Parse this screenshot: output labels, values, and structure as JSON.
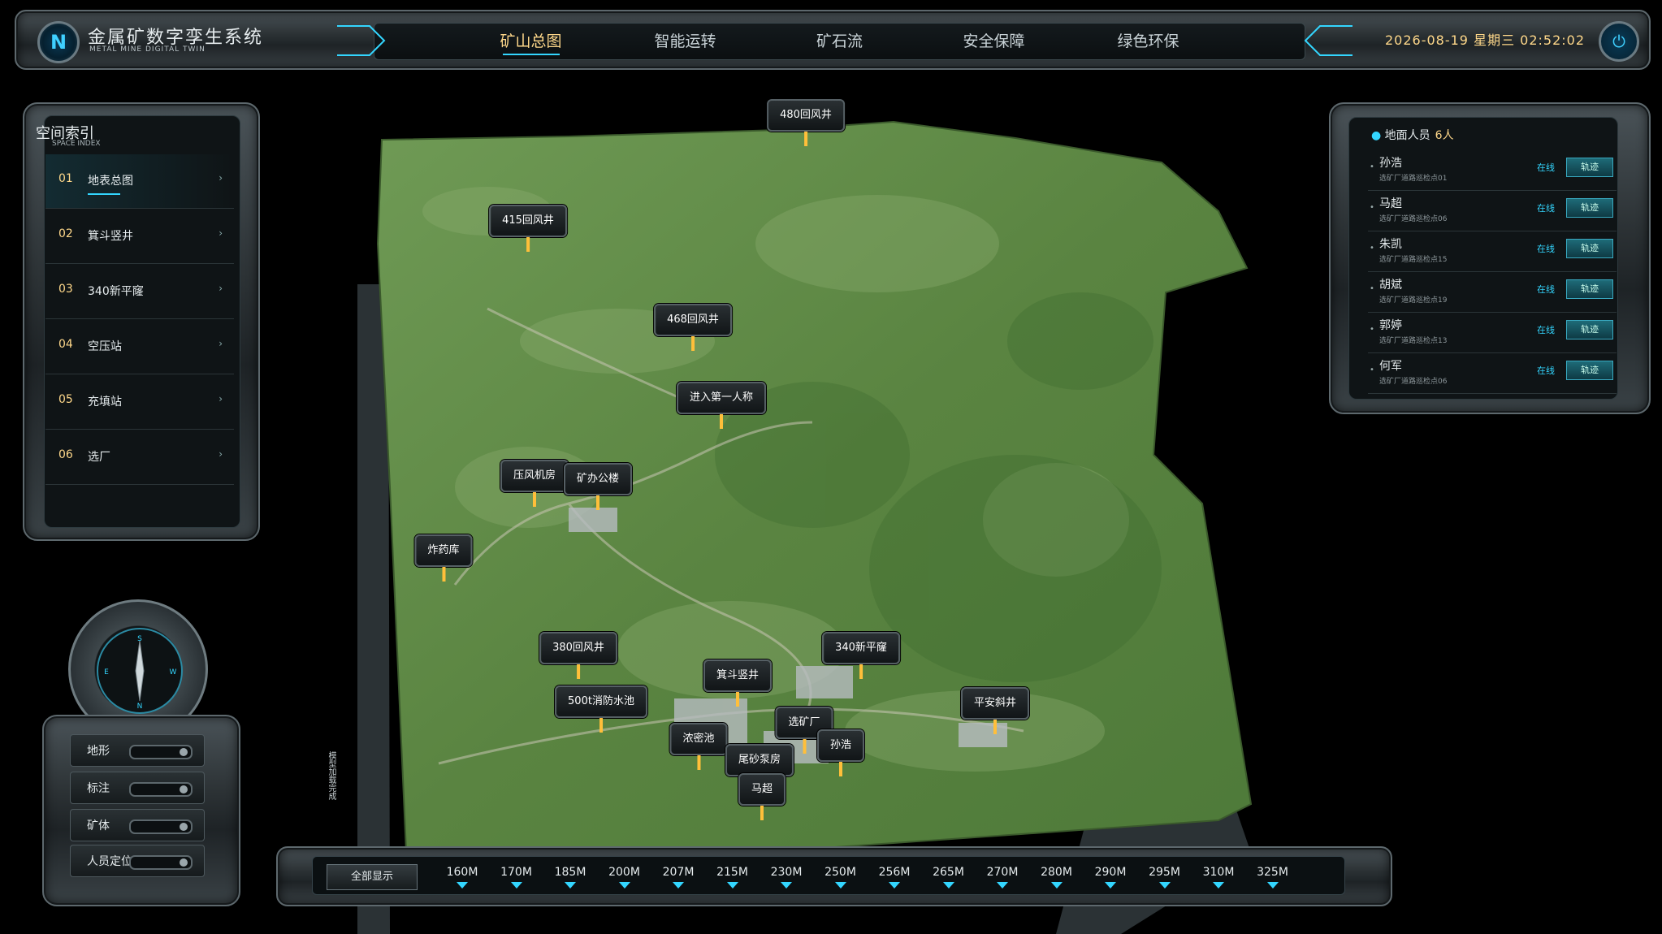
{
  "header": {
    "title": "金属矿数字孪生系统",
    "subtitle": "METAL MINE DIGITAL TWIN",
    "logo_letter": "N",
    "tabs": [
      {
        "label": "矿山总图",
        "active": true
      },
      {
        "label": "智能运转",
        "active": false
      },
      {
        "label": "矿石流",
        "active": false
      },
      {
        "label": "安全保障",
        "active": false
      },
      {
        "label": "绿色环保",
        "active": false
      }
    ],
    "datetime": "2026-08-19  星期三  02:52:02",
    "power_icon": "power-icon"
  },
  "index_panel": {
    "title": "空间索引",
    "subtitle": "SPACE INDEX",
    "items": [
      {
        "num": "01",
        "label": "地表总图",
        "active": true
      },
      {
        "num": "02",
        "label": "箕斗竖井",
        "active": false
      },
      {
        "num": "03",
        "label": "340新平窿",
        "active": false
      },
      {
        "num": "04",
        "label": "空压站",
        "active": false
      },
      {
        "num": "05",
        "label": "充填站",
        "active": false
      },
      {
        "num": "06",
        "label": "选厂",
        "active": false
      }
    ],
    "arrow": "›"
  },
  "people_panel": {
    "title": "地面人员",
    "count": "6人",
    "people": [
      {
        "name": "孙浩",
        "location": "选矿厂道路巡检点01",
        "status": "在线",
        "action": "轨迹"
      },
      {
        "name": "马超",
        "location": "选矿厂道路巡检点06",
        "status": "在线",
        "action": "轨迹"
      },
      {
        "name": "朱凯",
        "location": "选矿厂道路巡检点15",
        "status": "在线",
        "action": "轨迹"
      },
      {
        "name": "胡斌",
        "location": "选矿厂道路巡检点19",
        "status": "在线",
        "action": "轨迹"
      },
      {
        "name": "郭婷",
        "location": "选矿厂道路巡检点13",
        "status": "在线",
        "action": "轨迹"
      },
      {
        "name": "何军",
        "location": "选矿厂道路巡检点06",
        "status": "在线",
        "action": "轨迹"
      }
    ]
  },
  "map": {
    "markers": [
      {
        "label": "480回风井"
      },
      {
        "label": "415回风井"
      },
      {
        "label": "468回风井"
      },
      {
        "label": "进入第一人称"
      },
      {
        "label": "压风机房"
      },
      {
        "label": "矿办公楼"
      },
      {
        "label": "炸药库"
      },
      {
        "label": "380回风井"
      },
      {
        "label": "340新平窿"
      },
      {
        "label": "箕斗竖井"
      },
      {
        "label": "500t消防水池"
      },
      {
        "label": "平安斜井"
      },
      {
        "label": "选矿厂"
      },
      {
        "label": "浓密池"
      },
      {
        "label": "孙浩"
      },
      {
        "label": "尾砂泵房"
      },
      {
        "label": "马超"
      }
    ],
    "vertical_label": "模型加载完成"
  },
  "compass": {
    "labels": [
      "N",
      "E",
      "S",
      "W"
    ]
  },
  "layers": [
    {
      "label": "地形"
    },
    {
      "label": "标注"
    },
    {
      "label": "矿体"
    },
    {
      "label": "人员定位"
    }
  ],
  "elevation_bar": {
    "show_all": "全部显示",
    "levels": [
      "160M",
      "170M",
      "185M",
      "200M",
      "207M",
      "215M",
      "230M",
      "250M",
      "256M",
      "265M",
      "270M",
      "280M",
      "290M",
      "295M",
      "310M",
      "325M"
    ]
  },
  "colors": {
    "accent": "#33d6ff",
    "highlight": "#ffd88a",
    "pin": "#ffbf3a",
    "terrain": "#5f8a46"
  }
}
